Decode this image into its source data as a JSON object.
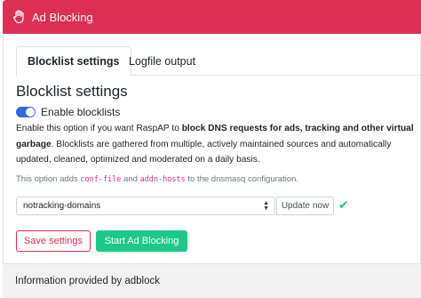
{
  "header": {
    "icon": "hand-paper-icon",
    "title": "Ad Blocking",
    "color": "#dc2f52"
  },
  "tabs": [
    {
      "label": "Blocklist settings",
      "active": true
    },
    {
      "label": "Logfile output",
      "active": false
    }
  ],
  "main": {
    "title": "Blocklist settings",
    "toggle_label": "Enable blocklists",
    "toggle_on": true,
    "description": {
      "part1": "Enable this option if you want RaspAP to ",
      "bold1": "block DNS requests for ads, tracking and other virtual garbage",
      "part2": ". Blocklists are gathered from multiple, actively maintained sources and automatically updated, cleaned, optimized and moderated on a daily basis."
    },
    "note": {
      "prefix": "This option adds ",
      "code1": "conf-file",
      "middle": " and ",
      "code2": "addn-hosts",
      "suffix": " to the dnsmasq configuration."
    },
    "select_value": "notracking-domains",
    "update_label": "Update now",
    "save_label": "Save settings",
    "start_label": "Start Ad Blocking"
  },
  "footer": {
    "text": "Information provided by adblock"
  }
}
